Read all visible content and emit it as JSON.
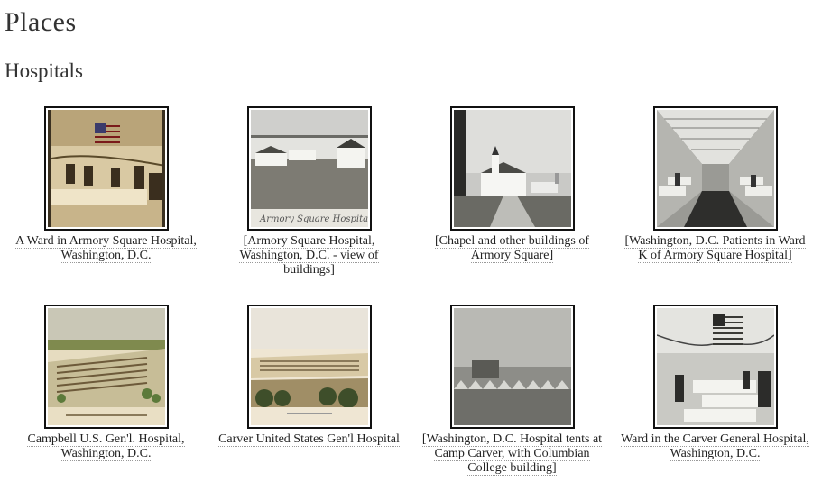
{
  "page": {
    "title": "Places",
    "section": "Hospitals"
  },
  "items": [
    {
      "caption": "A Ward in Armory Square Hospital, Washington, D.C.",
      "image": "hospital-ward-photo"
    },
    {
      "caption": "[Armory Square Hospital, Washington, D.C. - view of buildings]",
      "image": "hospital-buildings-photo"
    },
    {
      "caption": "[Chapel and other buildings of Armory Square]",
      "image": "chapel-photo"
    },
    {
      "caption": "[Washington, D.C. Patients in Ward K of Armory Square Hospital]",
      "image": "ward-interior-photo"
    },
    {
      "caption": "Campbell U.S. Gen'l. Hospital, Washington, D.C.",
      "image": "hospital-lithograph"
    },
    {
      "caption": "Carver United States Gen'l Hospital",
      "image": "hospital-panorama-print"
    },
    {
      "caption": "[Washington, D.C. Hospital tents at Camp Carver, with Columbian College building]",
      "image": "hospital-tents-photo"
    },
    {
      "caption": "Ward in the Carver General Hospital, Washington, D.C.",
      "image": "ward-flag-photo"
    }
  ]
}
